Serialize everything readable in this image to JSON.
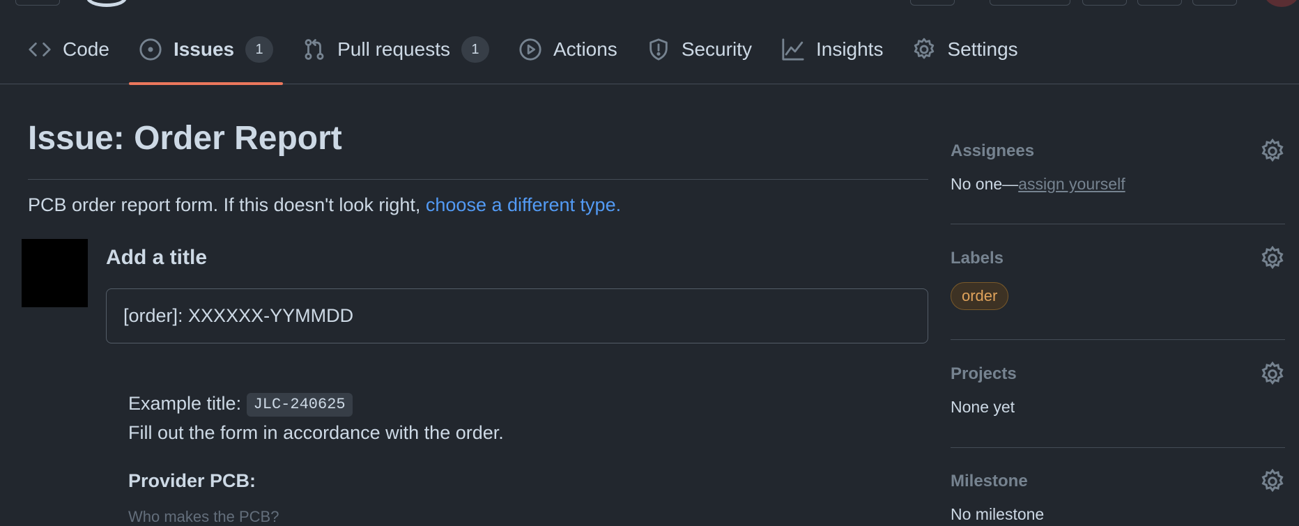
{
  "tabs": [
    {
      "label": "Code",
      "icon": "code-icon"
    },
    {
      "label": "Issues",
      "icon": "issue-opened-icon",
      "count": "1",
      "active": true
    },
    {
      "label": "Pull requests",
      "icon": "git-pull-request-icon",
      "count": "1"
    },
    {
      "label": "Actions",
      "icon": "play-icon"
    },
    {
      "label": "Security",
      "icon": "shield-icon"
    },
    {
      "label": "Insights",
      "icon": "graph-icon"
    },
    {
      "label": "Settings",
      "icon": "gear-icon"
    }
  ],
  "main": {
    "title": "Issue: Order Report",
    "intro_text": "PCB order report form. If this doesn't look right, ",
    "intro_link": "choose a different type.",
    "title_field_label": "Add a title",
    "title_field_value": "[order]: XXXXXX-YYMMDD",
    "desc_example_prefix": "Example title: ",
    "desc_example_code": "JLC-240625",
    "desc_line2": "Fill out the form in accordance with the order.",
    "provider_label": "Provider PCB:",
    "provider_hint": "Who makes the PCB?"
  },
  "sidebar": {
    "assignees": {
      "heading": "Assignees",
      "prefix": "No one—",
      "link": "assign yourself"
    },
    "labels": {
      "heading": "Labels",
      "items": [
        "order"
      ]
    },
    "projects": {
      "heading": "Projects",
      "value": "None yet"
    },
    "milestone": {
      "heading": "Milestone",
      "value": "No milestone"
    }
  },
  "colors": {
    "background": "#22272e",
    "accent_underline": "#ec775c",
    "link": "#539bf5",
    "label_order": "#e0a35b"
  }
}
